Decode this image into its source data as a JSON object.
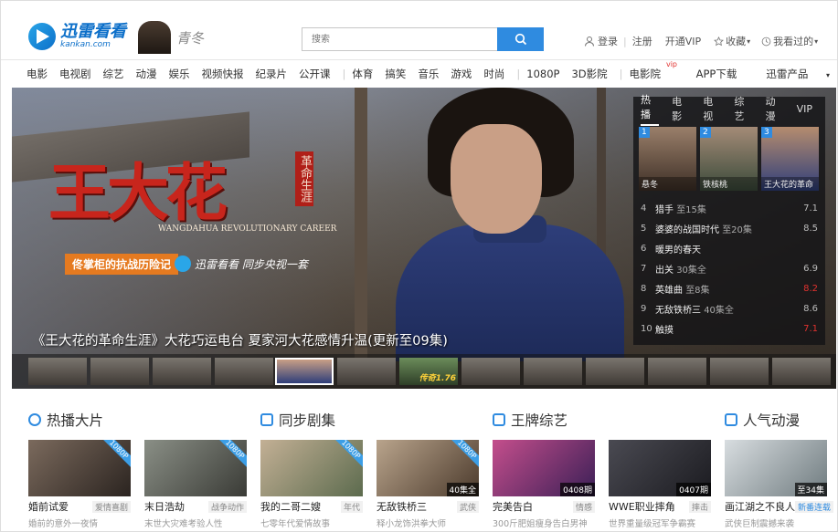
{
  "header": {
    "logo_cn": "迅雷看看",
    "logo_en": "kankan.com",
    "promo_text": "青冬",
    "search_placeholder": "搜索",
    "login": "登录",
    "register": "注册",
    "vip": "开通VIP",
    "favorites": "收藏",
    "history": "我看过的"
  },
  "nav": {
    "items": [
      "电影",
      "电视剧",
      "综艺",
      "动漫",
      "娱乐",
      "视频快报",
      "纪录片",
      "公开课",
      "体育",
      "搞笑",
      "音乐",
      "游戏",
      "时尚",
      "1080P",
      "3D影院",
      "电影院"
    ],
    "vip_sup": "vip",
    "app": "APP下载",
    "products": "迅雷产品"
  },
  "hero": {
    "title_big": "王大花",
    "title_sub": "革命生涯",
    "title_en": "WANGDAHUA REVOLUTIONARY CAREER",
    "tag_orange": "佟掌柜的抗战历险记",
    "tag_brand": "迅雷看看 同步央视一套",
    "caption": "《王大花的革命生涯》大花巧运电台 夏家河大花感情升温(更新至09集)",
    "thumb_badge": "传奇1.76"
  },
  "hot_panel": {
    "tabs": [
      "热播",
      "电影",
      "电视",
      "综艺",
      "动漫",
      "VIP"
    ],
    "top": [
      {
        "num": "1",
        "title": "悬冬"
      },
      {
        "num": "2",
        "title": "铁核桃"
      },
      {
        "num": "3",
        "title": "王大花的革命"
      }
    ],
    "list": [
      {
        "n": "4",
        "title": "猎手",
        "ep": "至15集",
        "score": "7.1"
      },
      {
        "n": "5",
        "title": "婆婆的战国时代",
        "ep": "至20集",
        "score": "8.5"
      },
      {
        "n": "6",
        "title": "暖男的春天",
        "ep": "",
        "score": ""
      },
      {
        "n": "7",
        "title": "出关",
        "ep": "30集全",
        "score": "6.9"
      },
      {
        "n": "8",
        "title": "英雄曲",
        "ep": "至8集",
        "score": "8.2"
      },
      {
        "n": "9",
        "title": "无敌铁桥三",
        "ep": "40集全",
        "score": "8.6"
      },
      {
        "n": "10",
        "title": "触摸",
        "ep": "",
        "score": "7.1"
      }
    ]
  },
  "sections": [
    {
      "title": "热播大片"
    },
    {
      "title": "同步剧集"
    },
    {
      "title": "王牌综艺"
    },
    {
      "title": "人气动漫"
    }
  ],
  "cards": [
    {
      "title": "婚前试爱",
      "tag": "爱情喜剧",
      "desc": "婚前的意外一夜情",
      "badge": "1080P",
      "ep": ""
    },
    {
      "title": "末日浩劫",
      "tag": "战争动作",
      "desc": "末世大灾难考验人性",
      "badge": "1080P",
      "ep": ""
    },
    {
      "title": "我的二哥二嫂",
      "tag": "年代",
      "desc": "七零年代爱情故事",
      "badge": "1080P",
      "ep": ""
    },
    {
      "title": "无敌铁桥三",
      "tag": "武侠",
      "desc": "释小龙饰洪拳大师",
      "badge": "1080P",
      "ep": "40集全"
    },
    {
      "title": "完美告白",
      "tag": "情感",
      "desc": "300斤肥姐瘦身告白男神",
      "badge": "",
      "ep": "0408期"
    },
    {
      "title": "WWE职业摔角",
      "tag": "摔击",
      "desc": "世界重量级冠军争霸赛",
      "badge": "",
      "ep": "0407期"
    },
    {
      "title": "画江湖之不良人",
      "tag": "新番连载",
      "desc": "武侠巨制震撼来袭",
      "badge": "",
      "ep": "至34集"
    }
  ],
  "colors": {
    "brand_blue": "#2f8be0",
    "hero_red": "#c8251c",
    "tag_orange": "#e57a20"
  }
}
